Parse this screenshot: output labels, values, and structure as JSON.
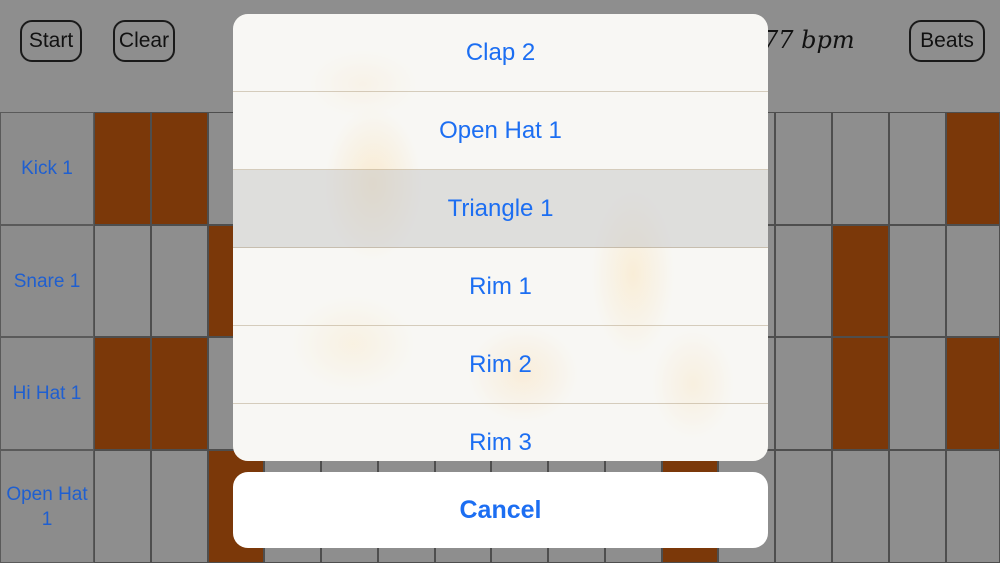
{
  "toolbar": {
    "start_label": "Start",
    "clear_label": "Clear",
    "tempo_label": "77 bpm",
    "beats_label": "Beats"
  },
  "tracks": [
    {
      "label": "Kick 1",
      "steps": [
        1,
        1,
        0,
        0,
        0,
        0,
        0,
        0,
        0,
        0,
        0,
        0,
        0,
        0,
        0,
        1,
        0
      ]
    },
    {
      "label": "Snare 1",
      "steps": [
        0,
        0,
        1,
        0,
        0,
        0,
        0,
        0,
        0,
        0,
        0,
        0,
        0,
        1,
        0,
        0,
        0
      ]
    },
    {
      "label": "Hi Hat 1",
      "steps": [
        1,
        1,
        0,
        0,
        0,
        0,
        0,
        0,
        0,
        0,
        0,
        0,
        0,
        1,
        0,
        1,
        0
      ]
    },
    {
      "label": "Open Hat 1",
      "steps": [
        0,
        0,
        1,
        0,
        0,
        0,
        0,
        0,
        0,
        0,
        1,
        0,
        0,
        0,
        0,
        0,
        0
      ]
    }
  ],
  "colors": {
    "step_on": "#7b3809",
    "step_off": "#8e8e8e",
    "accent": "#1c6ef2"
  },
  "sound_picker": {
    "options": [
      "Clap 2",
      "Open Hat 1",
      "Triangle 1",
      "Rim 1",
      "Rim 2",
      "Rim 3"
    ],
    "highlighted_index": 2,
    "cancel_label": "Cancel"
  }
}
